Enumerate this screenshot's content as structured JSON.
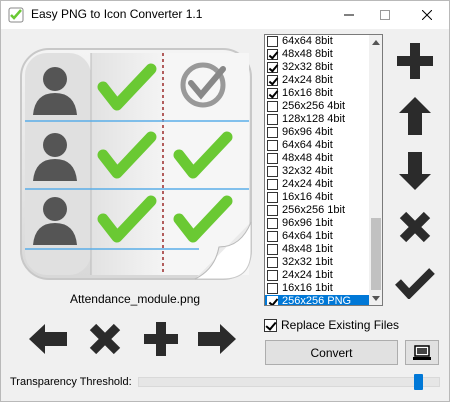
{
  "window": {
    "title": "Easy PNG to Icon Converter 1.1",
    "icon": "app-icon",
    "controls": {
      "minimize": "minimize-icon",
      "maximize": "maximize-icon",
      "close": "close-icon"
    }
  },
  "preview": {
    "filename": "Attendance_module.png",
    "image": "attendance-module-image"
  },
  "nav_buttons": [
    {
      "name": "previous-button",
      "icon": "arrow-left-icon"
    },
    {
      "name": "remove-image-button",
      "icon": "x-icon"
    },
    {
      "name": "add-image-button",
      "icon": "plus-icon"
    },
    {
      "name": "next-button",
      "icon": "arrow-right-icon"
    }
  ],
  "formats": [
    {
      "label": "64x64 8bit",
      "checked": false
    },
    {
      "label": "48x48 8bit",
      "checked": true
    },
    {
      "label": "32x32 8bit",
      "checked": true
    },
    {
      "label": "24x24 8bit",
      "checked": true
    },
    {
      "label": "16x16 8bit",
      "checked": true
    },
    {
      "label": "256x256 4bit",
      "checked": false
    },
    {
      "label": "128x128 4bit",
      "checked": false
    },
    {
      "label": "96x96 4bit",
      "checked": false
    },
    {
      "label": "64x64 4bit",
      "checked": false
    },
    {
      "label": "48x48 4bit",
      "checked": false
    },
    {
      "label": "32x32 4bit",
      "checked": false
    },
    {
      "label": "24x24 4bit",
      "checked": false
    },
    {
      "label": "16x16 4bit",
      "checked": false
    },
    {
      "label": "256x256 1bit",
      "checked": false
    },
    {
      "label": "96x96 1bit",
      "checked": false
    },
    {
      "label": "64x64 1bit",
      "checked": false
    },
    {
      "label": "48x48 1bit",
      "checked": false
    },
    {
      "label": "32x32 1bit",
      "checked": false
    },
    {
      "label": "24x24 1bit",
      "checked": false
    },
    {
      "label": "16x16 1bit",
      "checked": false
    },
    {
      "label": "256x256 PNG",
      "checked": true,
      "selected": true
    }
  ],
  "side_buttons": [
    {
      "name": "add-format-button",
      "icon": "plus-icon"
    },
    {
      "name": "move-up-button",
      "icon": "arrow-up-icon"
    },
    {
      "name": "move-down-button",
      "icon": "arrow-down-icon"
    },
    {
      "name": "delete-format-button",
      "icon": "x-icon"
    },
    {
      "name": "accept-button",
      "icon": "checkmark-icon"
    }
  ],
  "options": {
    "replace_existing_label": "Replace Existing Files",
    "replace_existing_checked": true
  },
  "actions": {
    "convert_label": "Convert",
    "desktop_icon": "computer-icon"
  },
  "threshold": {
    "label": "Transparency Threshold:",
    "value": 0.95
  },
  "colors": {
    "accent": "#0078d7",
    "icon_dark": "#2b2b2b",
    "check_green": "#6ac933"
  }
}
